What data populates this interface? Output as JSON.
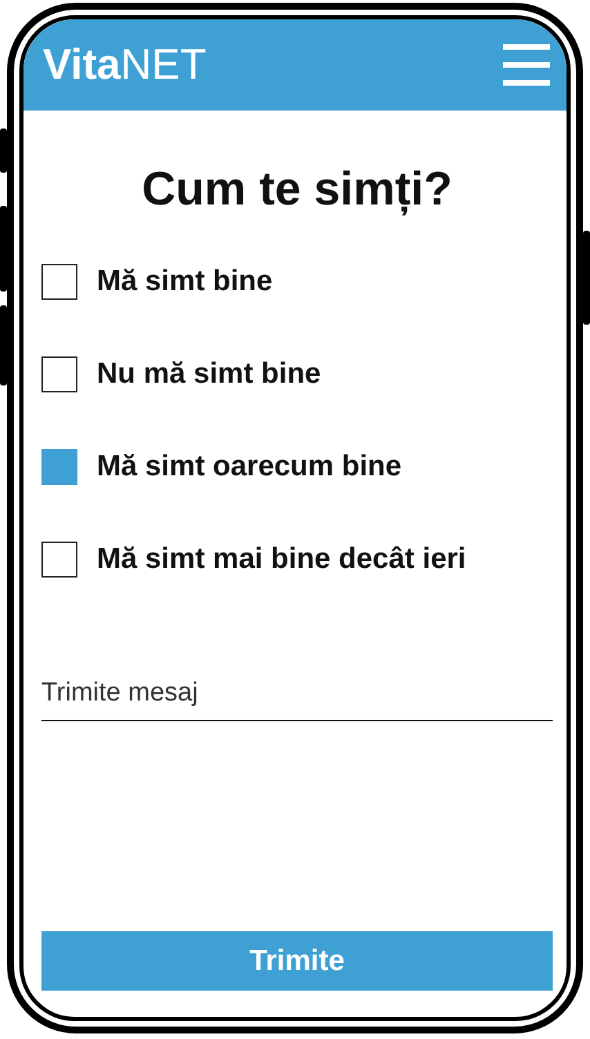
{
  "header": {
    "logo": "**Vita**NET"
  },
  "title": "Cum te simți?",
  "options": [
    {
      "label": "Mă simt bine",
      "checked": false
    },
    {
      "label": "Nu mă simt bine",
      "checked": false
    },
    {
      "label": "Mă simt oarecum bine",
      "checked": true
    },
    {
      "label": "Mă simt mai bine decât ieri",
      "checked": false
    }
  ],
  "message": {
    "placeholder": "Trimite mesaj"
  },
  "submit": "Trimite"
}
